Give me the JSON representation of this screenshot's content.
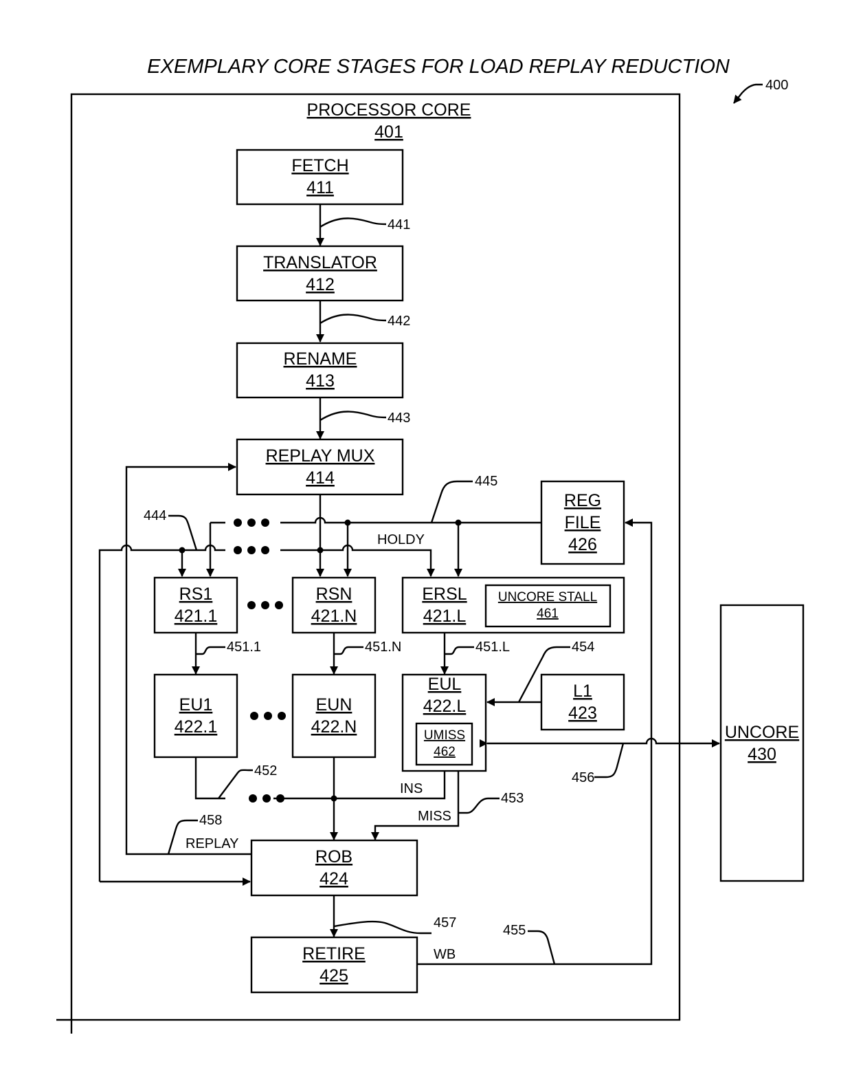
{
  "title": "EXEMPLARY CORE STAGES FOR LOAD REPLAY REDUCTION",
  "figure_ref": "400",
  "core": {
    "name": "PROCESSOR CORE",
    "ref": "401"
  },
  "blocks": {
    "fetch": {
      "name": "FETCH",
      "ref": "411"
    },
    "translator": {
      "name": "TRANSLATOR",
      "ref": "412"
    },
    "rename": {
      "name": "RENAME",
      "ref": "413"
    },
    "replay_mux": {
      "name": "REPLAY MUX",
      "ref": "414"
    },
    "rs1": {
      "name": "RS1",
      "ref": "421.1"
    },
    "rsn": {
      "name": "RSN",
      "ref": "421.N"
    },
    "ersl": {
      "name": "ERSL",
      "ref": "421.L"
    },
    "uncore_stall": {
      "name": "UNCORE STALL",
      "ref": "461"
    },
    "eu1": {
      "name": "EU1",
      "ref": "422.1"
    },
    "eun": {
      "name": "EUN",
      "ref": "422.N"
    },
    "eul": {
      "name": "EUL",
      "ref": "422.L"
    },
    "umiss": {
      "name": "UMISS",
      "ref": "462"
    },
    "l1": {
      "name": "L1",
      "ref": "423"
    },
    "reg_file": {
      "name1": "REG",
      "name2": "FILE",
      "ref": "426"
    },
    "rob": {
      "name": "ROB",
      "ref": "424"
    },
    "retire": {
      "name": "RETIRE",
      "ref": "425"
    },
    "uncore": {
      "name": "UNCORE",
      "ref": "430"
    }
  },
  "connections": {
    "c441": "441",
    "c442": "442",
    "c443": "443",
    "c444": "444",
    "c445": "445",
    "c451_1": "451.1",
    "c451_n": "451.N",
    "c451_l": "451.L",
    "c452": "452",
    "c453": "453",
    "c454": "454",
    "c455": "455",
    "c456": "456",
    "c457": "457",
    "c458": "458"
  },
  "signals": {
    "holdy": "HOLDY",
    "ins": "INS",
    "miss": "MISS",
    "replay": "REPLAY",
    "wb": "WB"
  }
}
